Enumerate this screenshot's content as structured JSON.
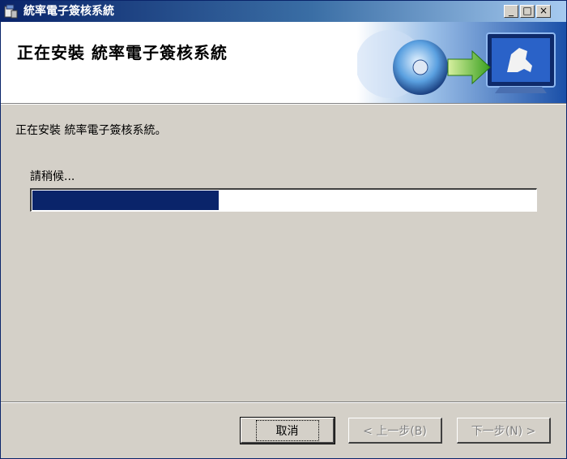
{
  "window": {
    "title": "統率電子簽核系統",
    "controls": {
      "minimize": "_",
      "maximize": "□",
      "close": "×"
    }
  },
  "header": {
    "title": "正在安裝 統率電子簽核系統"
  },
  "body": {
    "status_message": "正在安裝 統率電子簽核系統。",
    "wait_label": "請稍候...",
    "progress_fraction": 0.37
  },
  "buttons": {
    "cancel": "取消",
    "back": "< 上一步(B)",
    "next": "下一步(N) >"
  },
  "colors": {
    "titlebar_start": "#0a246a",
    "progress_fill": "#0a246a",
    "dialog_bg": "#d4d0c8"
  }
}
